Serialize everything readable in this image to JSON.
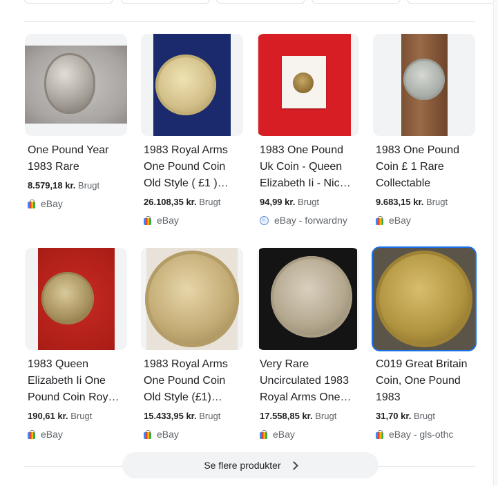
{
  "products": [
    {
      "title": "One Pound Year 1983 Rare",
      "price": "8.579,18 kr.",
      "condition": "Brugt",
      "store": "eBay",
      "store_icon": "shopping-bag-icon"
    },
    {
      "title": "1983 Royal Arms One Pound Coin Old Style ( £1 )…",
      "price": "26.108,35 kr.",
      "condition": "Brugt",
      "store": "eBay",
      "store_icon": "shopping-bag-icon"
    },
    {
      "title": "1983 One Pound Uk Coin - Queen Elizabeth Ii - Nic…",
      "price": "94,99 kr.",
      "condition": "Brugt",
      "store": "eBay - forwardny",
      "store_icon": "globe-icon"
    },
    {
      "title": "1983 One Pound Coin £ 1 Rare Collectable",
      "price": "9.683,15 kr.",
      "condition": "Brugt",
      "store": "eBay",
      "store_icon": "shopping-bag-icon"
    },
    {
      "title": "1983 Queen Elizabeth Ii One Pound Coin Roy…",
      "price": "190,61 kr.",
      "condition": "Brugt",
      "store": "eBay",
      "store_icon": "shopping-bag-icon"
    },
    {
      "title": "1983 Royal Arms One Pound Coin Old Style (£1)…",
      "price": "15.433,95 kr.",
      "condition": "Brugt",
      "store": "eBay",
      "store_icon": "shopping-bag-icon"
    },
    {
      "title": "Very Rare Uncirculated 1983 Royal Arms One…",
      "price": "17.558,85 kr.",
      "condition": "Brugt",
      "store": "eBay",
      "store_icon": "shopping-bag-icon"
    },
    {
      "title": "C019 Great Britain Coin, One Pound 1983",
      "price": "31,70 kr.",
      "condition": "Brugt",
      "store": "eBay - gls-othc",
      "store_icon": "shopping-bag-icon"
    }
  ],
  "more_button": {
    "label": "Se flere produkter",
    "icon": "chevron-right-icon"
  },
  "colors": {
    "selected_outline": "#1a73e8",
    "price_text": "#202124",
    "muted_text": "#5f6368",
    "button_bg": "#f1f3f4"
  }
}
